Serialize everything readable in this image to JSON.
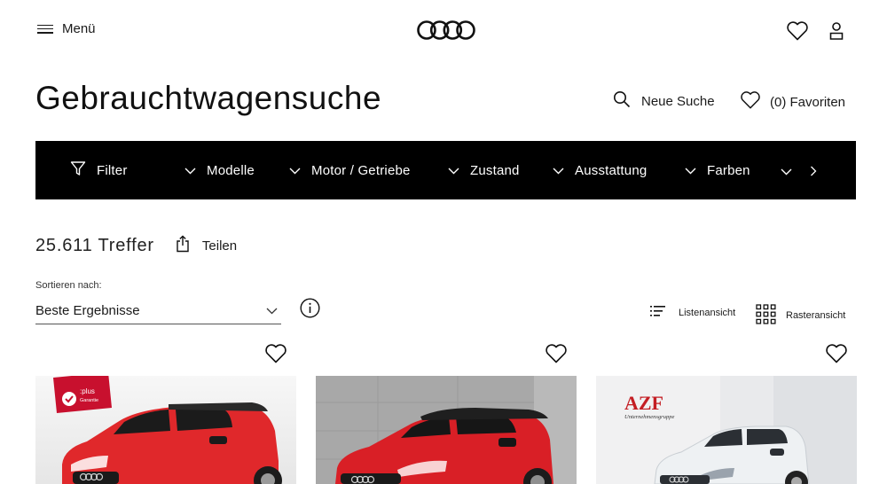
{
  "header": {
    "menu_label": "Menü"
  },
  "page": {
    "title": "Gebrauchtwagensuche",
    "new_search_label": "Neue Suche",
    "favorites_label": "(0) Favoriten"
  },
  "filterbar": {
    "filter_label": "Filter",
    "items": [
      "Modelle",
      "Motor / Getriebe",
      "Zustand",
      "Ausstattung",
      "Farben"
    ]
  },
  "results": {
    "count": "25.611 Treffer",
    "share_label": "Teilen"
  },
  "sort": {
    "label": "Sortieren nach:",
    "value": "Beste Ergebnisse"
  },
  "views": {
    "list_label": "Listenansicht",
    "grid_label": "Rasteransicht"
  },
  "cards": [
    {
      "badge_line1": ":plus",
      "badge_line2": "Garantie",
      "car_color": "#e0282b"
    },
    {
      "car_color": "#d91f26"
    },
    {
      "dealer": "AZF",
      "dealer_sub": "Unternehmensgruppe",
      "car_color": "#eef1f3"
    }
  ],
  "colors": {
    "accent_black": "#000000",
    "badge_red": "#c8102e"
  }
}
